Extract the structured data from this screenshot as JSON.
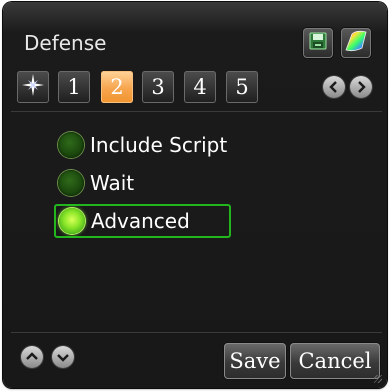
{
  "header": {
    "title": "Defense",
    "buttons": [
      {
        "icon": "save-disk-icon"
      },
      {
        "icon": "color-palette-icon"
      }
    ]
  },
  "tabs": {
    "star_icon": "compass-star-icon",
    "items": [
      {
        "label": "1",
        "active": false
      },
      {
        "label": "2",
        "active": true
      },
      {
        "label": "3",
        "active": false
      },
      {
        "label": "4",
        "active": false
      },
      {
        "label": "5",
        "active": false
      }
    ],
    "nav": [
      "chevron-left-icon",
      "chevron-right-icon"
    ]
  },
  "options": [
    {
      "label": "Include Script",
      "checked": false
    },
    {
      "label": "Wait",
      "checked": false
    },
    {
      "label": "Advanced",
      "checked": true
    }
  ],
  "footer": {
    "nav": [
      "chevron-up-icon",
      "chevron-down-icon"
    ],
    "save_label": "Save",
    "cancel_label": "Cancel"
  },
  "colors": {
    "accent_tab": "#f7a54e",
    "selection_border": "#22b51e",
    "radio_on": "#8ee82a",
    "panel_bg": "#181818"
  }
}
